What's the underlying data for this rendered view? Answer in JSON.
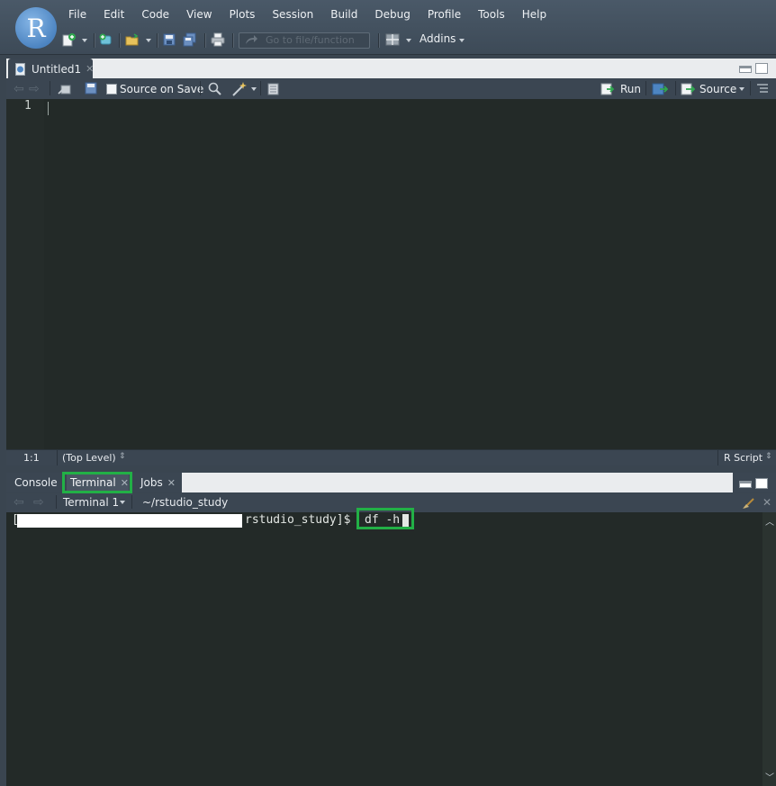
{
  "app": {
    "logo_letter": "R"
  },
  "menu": [
    "File",
    "Edit",
    "Code",
    "View",
    "Plots",
    "Session",
    "Build",
    "Debug",
    "Profile",
    "Tools",
    "Help"
  ],
  "toolbar": {
    "goto_placeholder": "Go to file/function",
    "addins_label": "Addins",
    "icons": [
      "new-file-icon",
      "new-project-icon",
      "open-file-icon",
      "save-icon",
      "save-all-icon",
      "print-icon",
      "workspace-panes-icon"
    ]
  },
  "source": {
    "tab_label": "Untitled1",
    "source_on_save_label": "Source on Save",
    "source_on_save_checked": false,
    "run_label": "Run",
    "source_label": "Source",
    "line_numbers": [
      "1"
    ],
    "status_position": "1:1",
    "status_scope": "(Top Level)",
    "status_filetype": "R Script"
  },
  "bottom": {
    "tabs": [
      {
        "label": "Console",
        "active": false,
        "closable": false
      },
      {
        "label": "Terminal",
        "active": true,
        "closable": true
      },
      {
        "label": "Jobs",
        "active": false,
        "closable": true
      }
    ],
    "terminal_selector": "Terminal 1",
    "terminal_path": "~/rstudio_study",
    "prompt_open": "[",
    "prompt_rest": "rstudio_study]$",
    "command": "df -h"
  },
  "colors": {
    "highlight": "#22b046",
    "editor_bg": "#232a28",
    "chrome_bg": "#3b4652"
  }
}
